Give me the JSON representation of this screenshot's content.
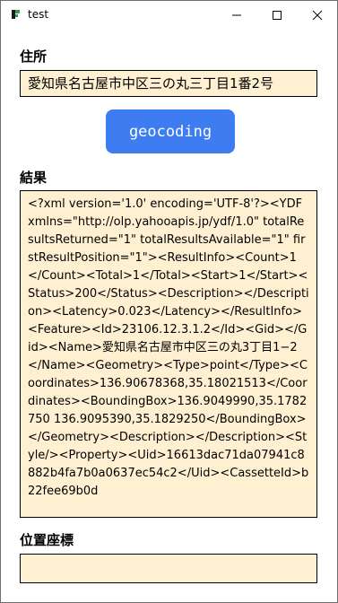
{
  "window": {
    "title": "test",
    "controls": {
      "minimize_icon": "minimize-icon",
      "maximize_icon": "maximize-icon",
      "close_icon": "close-icon"
    }
  },
  "address": {
    "label": "住所",
    "value": "愛知県名古屋市中区三の丸三丁目1番2号"
  },
  "geocode_button": {
    "label": "geocoding",
    "color": "#3d7cf1"
  },
  "result": {
    "label": "結果",
    "value": "<?xml version='1.0' encoding='UTF-8'?><YDF xmlns=\"http://olp.yahooapis.jp/ydf/1.0\" totalResultsReturned=\"1\" totalResultsAvailable=\"1\" firstResultPosition=\"1\"><ResultInfo><Count>1</Count><Total>1</Total><Start>1</Start><Status>200</Status><Description></Description><Latency>0.023</Latency></ResultInfo><Feature><Id>23106.12.3.1.2</Id><Gid></Gid><Name>愛知県名古屋市中区三の丸3丁目1−2</Name><Geometry><Type>point</Type><Coordinates>136.90678368,35.18021513</Coordinates><BoundingBox>136.9049990,35.1782750 136.9095390,35.1829250</BoundingBox></Geometry><Description></Description><Style/><Property><Uid>16613dac71da07941c8882b4fa7b0a0637ec54c2</Uid><CassetteId>b22fee69b0d"
  },
  "coordinates": {
    "label": "位置座標",
    "value": ""
  },
  "colors": {
    "field_background": "#fff0d2",
    "button": "#3d7cf1"
  }
}
